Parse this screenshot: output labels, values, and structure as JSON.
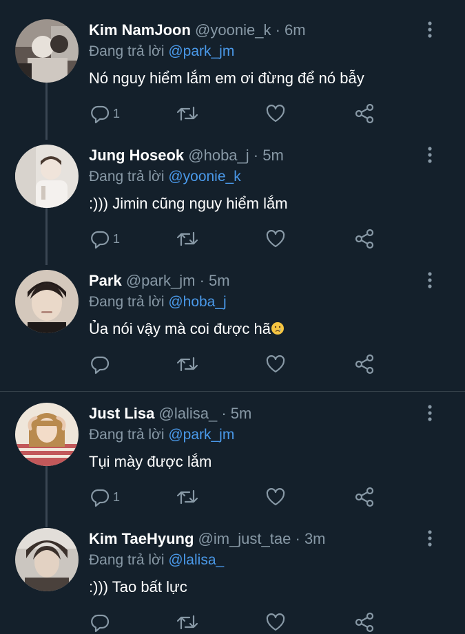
{
  "tweets": [
    {
      "name": "Kim NamJoon",
      "handle": "@yoonie_k",
      "dot": "·",
      "time": "6m",
      "reply_prefix": "Đang trả lời",
      "reply_to": "@park_jm",
      "text": "Nó nguy hiểm lắm em ơi đừng để nó bẫy",
      "reply_count": "1",
      "avatar_colors": [
        "#6b5f5a",
        "#d8d2cc"
      ]
    },
    {
      "name": "Jung Hoseok",
      "handle": "@hoba_j",
      "dot": "·",
      "time": "5m",
      "reply_prefix": "Đang trả lời",
      "reply_to": "@yoonie_k",
      "text": ":))) Jimin cũng nguy hiểm lắm",
      "reply_count": "1",
      "avatar_colors": [
        "#e6e2dd",
        "#5a4a40"
      ]
    },
    {
      "name": "Park",
      "handle": "@park_jm",
      "dot": "·",
      "time": "5m",
      "reply_prefix": "Đang trả lời",
      "reply_to": "@hoba_j",
      "text": "Ủa nói vậy mà coi được hã",
      "emoji": "crying-face",
      "reply_count": "",
      "avatar_colors": [
        "#d9cdc2",
        "#2b2220"
      ]
    },
    {
      "name": "Just Lisa",
      "handle": "@lalisa_",
      "dot": "·",
      "time": "5m",
      "reply_prefix": "Đang trả lời",
      "reply_to": "@park_jm",
      "text": "Tụi mày được lắm",
      "reply_count": "1",
      "avatar_colors": [
        "#e9d9c6",
        "#b98a4e"
      ]
    },
    {
      "name": "Kim TaeHyung",
      "handle": "@im_just_tae",
      "dot": "·",
      "time": "3m",
      "reply_prefix": "Đang trả lời",
      "reply_to": "@lalisa_",
      "text": ":))) Tao bất lực",
      "reply_count": "",
      "avatar_colors": [
        "#cfcac4",
        "#3a302b"
      ]
    }
  ],
  "icons": {
    "reply": "reply-icon",
    "retweet": "retweet-icon",
    "like": "like-icon",
    "share": "share-icon",
    "more": "more-icon"
  },
  "colors": {
    "background": "#14202b",
    "muted": "#8899a6",
    "mention": "#4a99e9",
    "line": "#3a4653"
  }
}
